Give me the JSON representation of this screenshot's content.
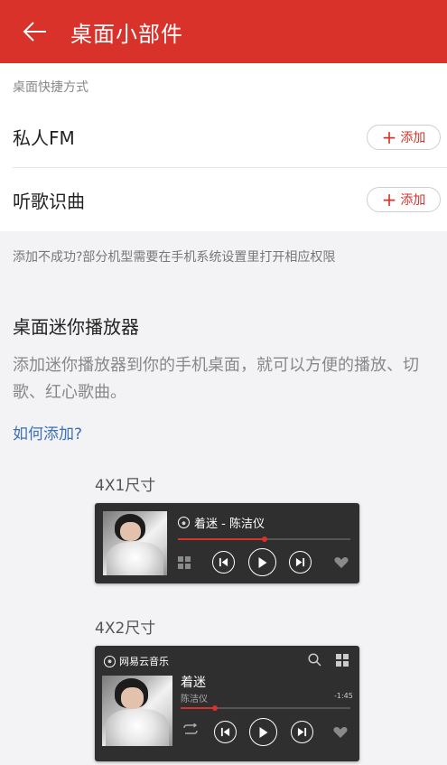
{
  "header": {
    "title": "桌面小部件"
  },
  "shortcuts": {
    "caption": "桌面快捷方式",
    "items": [
      {
        "label": "私人FM",
        "button": "添加"
      },
      {
        "label": "听歌识曲",
        "button": "添加"
      }
    ],
    "hint": "添加不成功?部分机型需要在手机系统设置里打开相应权限"
  },
  "mini_player": {
    "title": "桌面迷你播放器",
    "description": "添加迷你播放器到你的手机桌面，就可以方便的播放、切歌、红心歌曲。",
    "howto_link": "如何添加?"
  },
  "widget_4x1": {
    "size_label": "4X1尺寸",
    "now_playing": "着迷 - 陈洁仪",
    "progress": 0.5
  },
  "widget_4x2": {
    "size_label": "4X2尺寸",
    "brand": "网易云音乐",
    "song": "着迷",
    "artist": "陈洁仪",
    "time": "-1:45",
    "progress": 0.2
  },
  "colors": {
    "accent": "#d8322b",
    "link": "#3c6fb7",
    "widget_bg": "#2f2f2f"
  },
  "icons": [
    "back-arrow-icon",
    "plus-icon",
    "netease-logo-icon",
    "previous-icon",
    "play-icon",
    "next-icon",
    "heart-icon",
    "grid-icon",
    "search-icon",
    "repeat-icon"
  ]
}
